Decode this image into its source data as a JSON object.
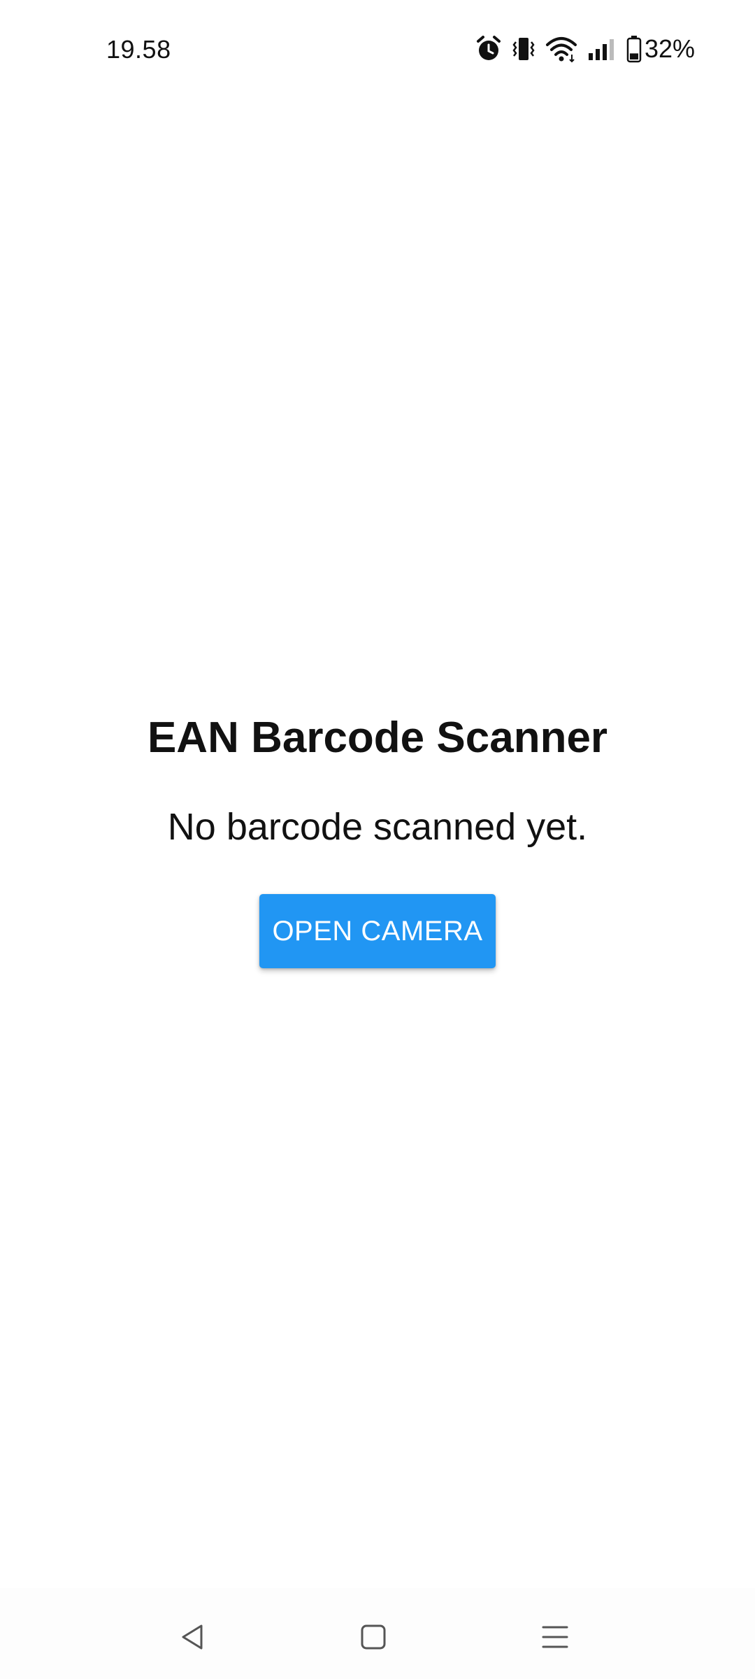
{
  "status_bar": {
    "time": "19.58",
    "battery_percent": "32%",
    "battery_level": 0.32,
    "icons": [
      "alarm-icon",
      "vibrate-icon",
      "wifi-icon",
      "cellular-signal-icon",
      "battery-icon"
    ]
  },
  "main": {
    "title": "EAN Barcode Scanner",
    "result_text": "No barcode scanned yet.",
    "open_camera_label": "OPEN CAMERA"
  },
  "nav_bar": {
    "icons": [
      "back-icon",
      "home-icon",
      "recents-menu-icon"
    ]
  },
  "colors": {
    "accent": "#2196F3",
    "text": "#111111",
    "background": "#ffffff"
  }
}
